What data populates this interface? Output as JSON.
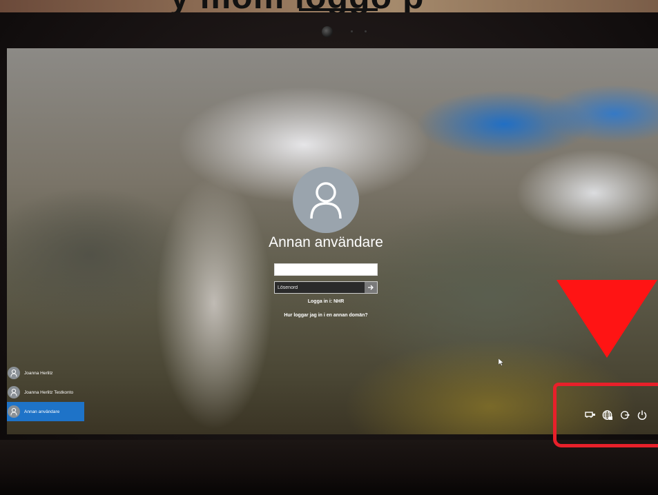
{
  "caption": {
    "text": "y            mom loggo p"
  },
  "login": {
    "username": "Annan användare",
    "password_placeholder": "Lösenord",
    "login_domain": "Logga in i: NHR",
    "help_link": "Hur loggar jag in i en annan domän?"
  },
  "users": [
    {
      "name": "Joanna Herlitz",
      "active": false
    },
    {
      "name": "Joanna Herlitz Testkonto",
      "active": false
    },
    {
      "name": "Annan användare",
      "active": true
    }
  ],
  "tray": {
    "icons": [
      "network-adapter-icon",
      "globe-network-icon",
      "accessibility-icon",
      "power-icon"
    ]
  },
  "colors": {
    "accent": "#1e73c8",
    "annotation_red": "#ff1414",
    "avatar_gray": "#9aa4ad"
  }
}
